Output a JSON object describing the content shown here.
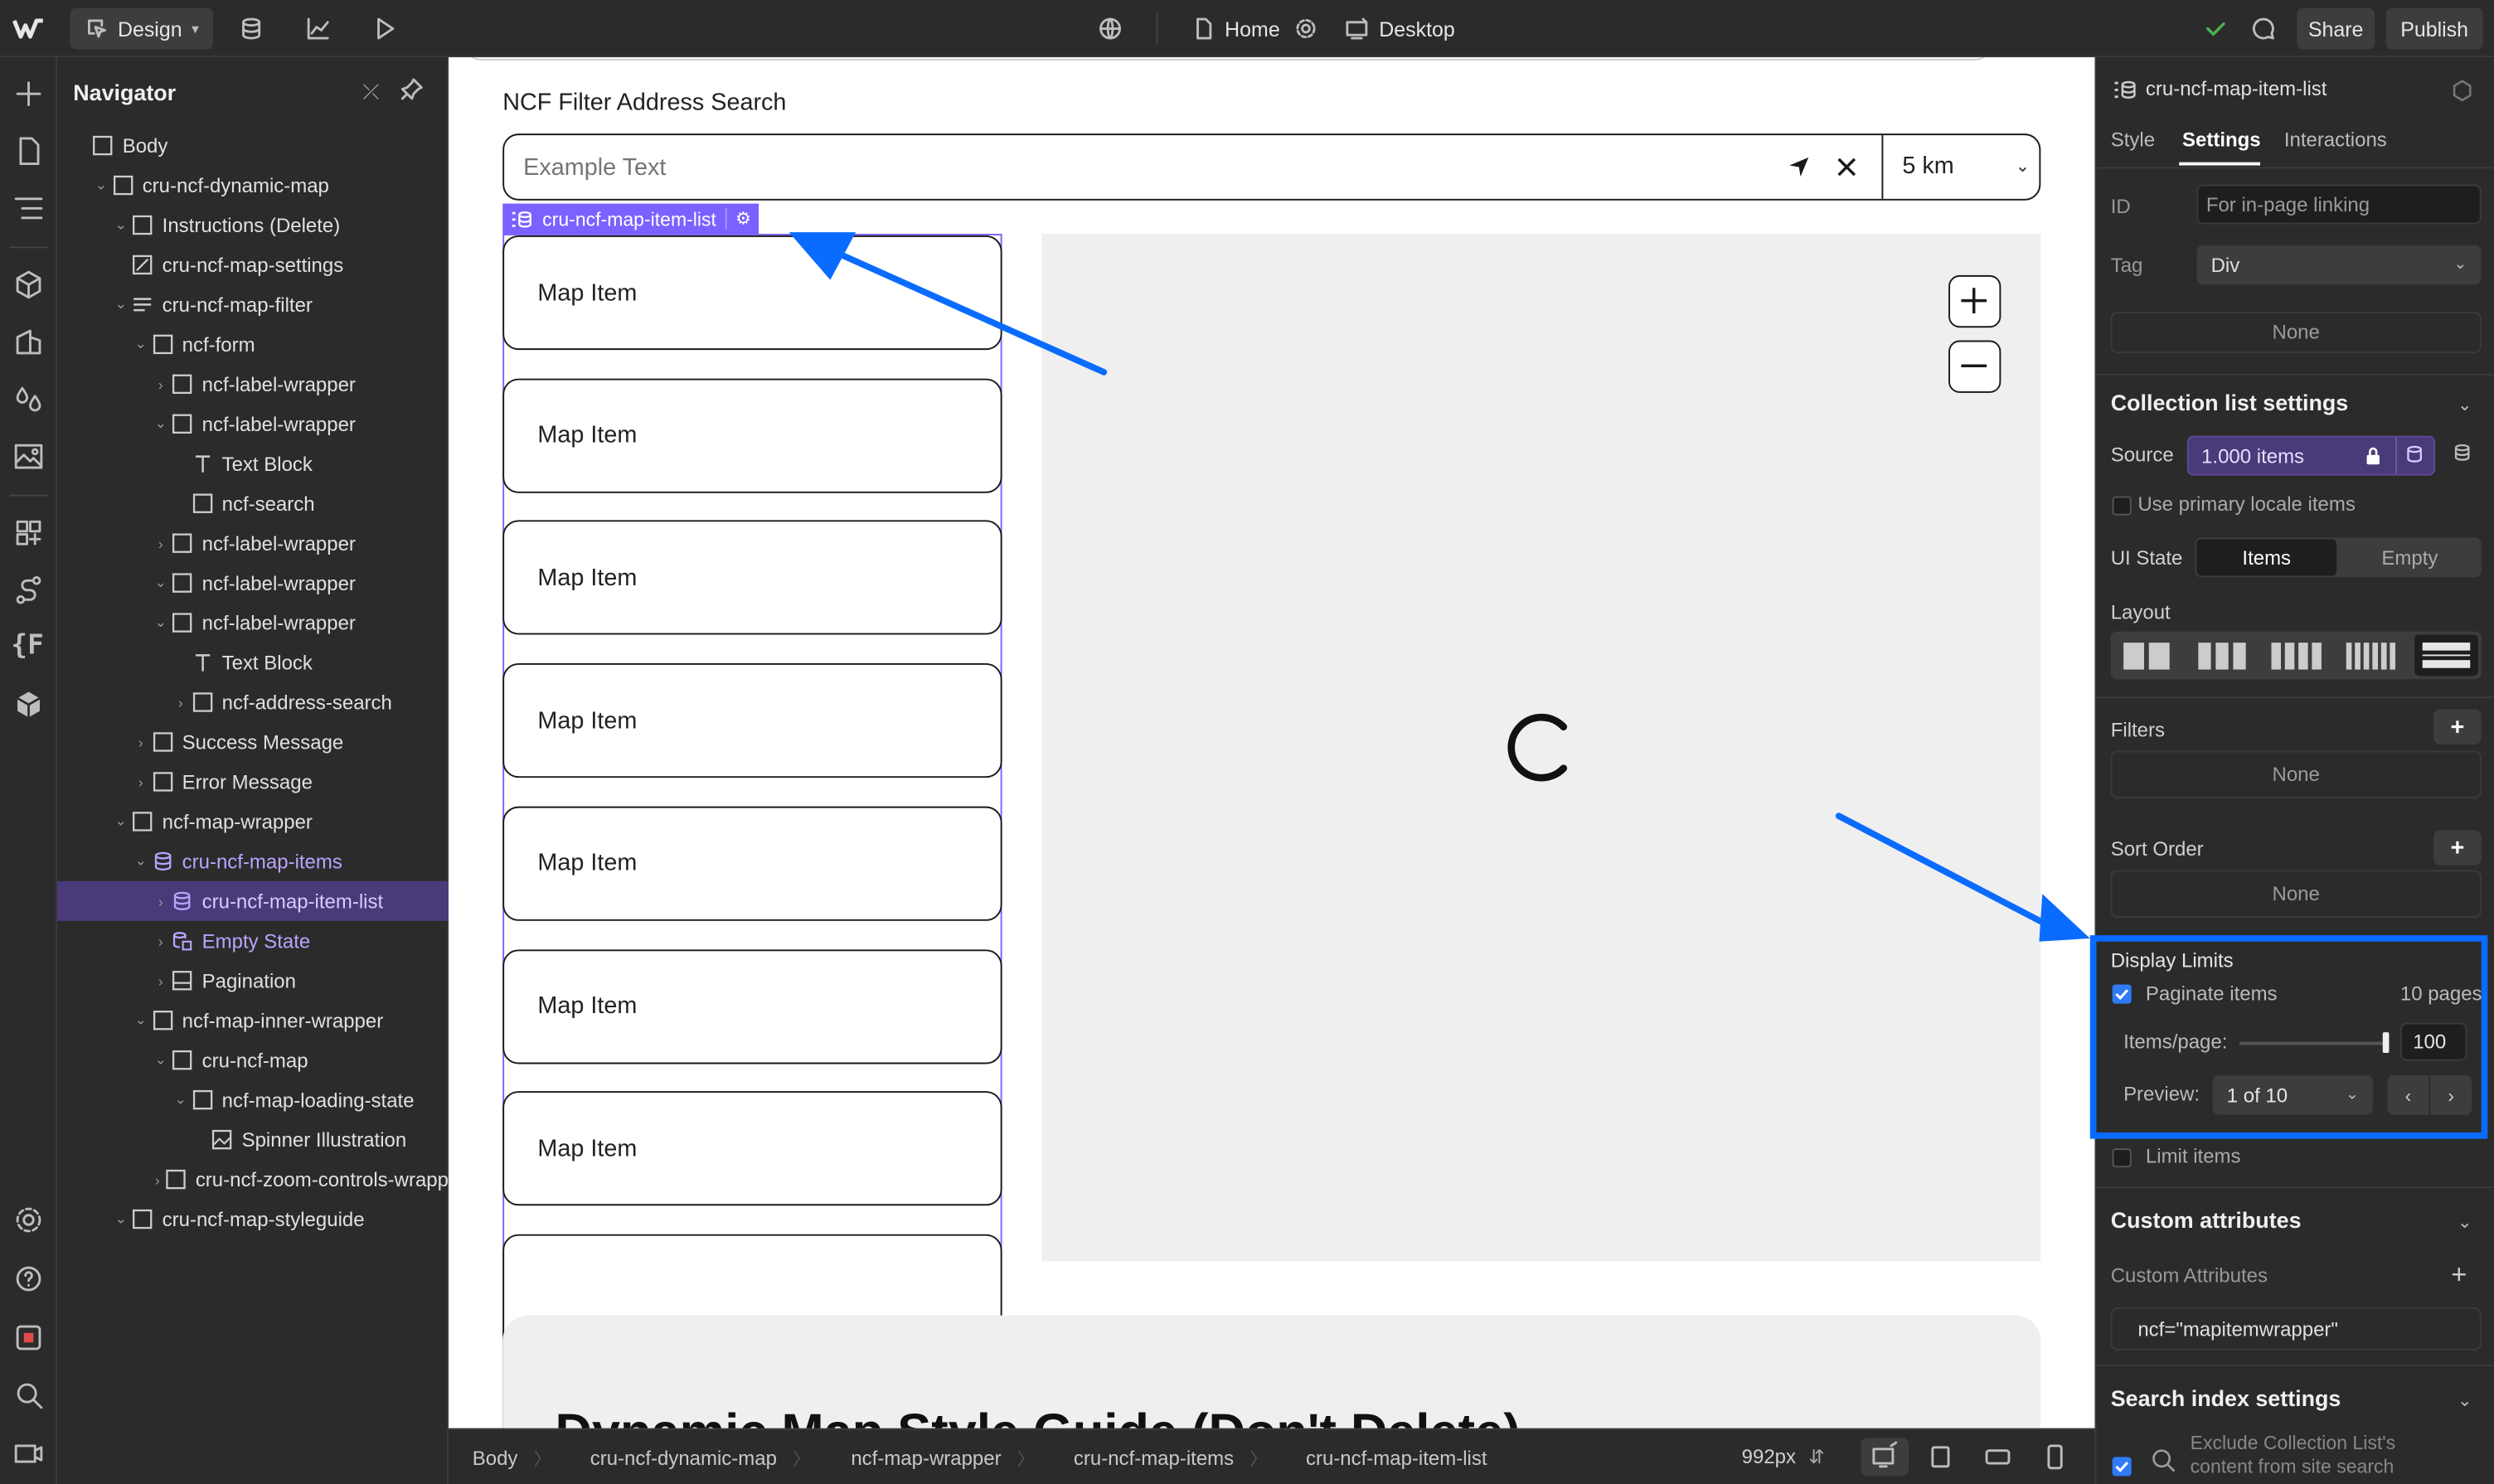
{
  "topbar": {
    "mode_label": "Design",
    "page_label": "Home",
    "breakpoint_label": "Desktop",
    "share_label": "Share",
    "publish_label": "Publish"
  },
  "navigator": {
    "title": "Navigator",
    "items": [
      {
        "label": "Body"
      },
      {
        "label": "cru-ncf-dynamic-map"
      },
      {
        "label": "Instructions (Delete)"
      },
      {
        "label": "cru-ncf-map-settings"
      },
      {
        "label": "cru-ncf-map-filter"
      },
      {
        "label": "ncf-form"
      },
      {
        "label": "ncf-label-wrapper"
      },
      {
        "label": "ncf-label-wrapper"
      },
      {
        "label": "Text Block"
      },
      {
        "label": "ncf-search"
      },
      {
        "label": "ncf-label-wrapper"
      },
      {
        "label": "ncf-label-wrapper"
      },
      {
        "label": "ncf-label-wrapper"
      },
      {
        "label": "Text Block"
      },
      {
        "label": "ncf-address-search"
      },
      {
        "label": "Success Message"
      },
      {
        "label": "Error Message"
      },
      {
        "label": "ncf-map-wrapper"
      },
      {
        "label": "cru-ncf-map-items"
      },
      {
        "label": "cru-ncf-map-item-list"
      },
      {
        "label": "Empty State"
      },
      {
        "label": "Pagination"
      },
      {
        "label": "ncf-map-inner-wrapper"
      },
      {
        "label": "cru-ncf-map"
      },
      {
        "label": "ncf-map-loading-state"
      },
      {
        "label": "Spinner Illustration"
      },
      {
        "label": "cru-ncf-zoom-controls-wrapp"
      },
      {
        "label": "cru-ncf-map-styleguide"
      }
    ]
  },
  "canvas": {
    "heading": "NCF Filter Address Search",
    "search_placeholder": "Example Text",
    "radius_value": "5 km",
    "selected_badge": "cru-ncf-map-item-list",
    "map_items": [
      "Map Item",
      "Map Item",
      "Map Item",
      "Map Item",
      "Map Item",
      "Map Item",
      "Map Item"
    ],
    "styleguide_heading": "Dynamic Map Style Guide (Don't Delete)"
  },
  "panel": {
    "element_name": "cru-ncf-map-item-list",
    "tabs": [
      "Style",
      "Settings",
      "Interactions"
    ],
    "id_label": "ID",
    "id_placeholder": "For in-page linking",
    "tag_label": "Tag",
    "tag_value": "Div",
    "none_label": "None",
    "collection_settings_title": "Collection list settings",
    "source_label": "Source",
    "source_value": "1.000 items",
    "primary_locale_label": "Use primary locale items",
    "ui_state_label": "UI State",
    "ui_state_items": "Items",
    "ui_state_empty": "Empty",
    "layout_label": "Layout",
    "filters_label": "Filters",
    "filters_value": "None",
    "sort_label": "Sort Order",
    "sort_value": "None",
    "display_limits_label": "Display Limits",
    "paginate_label": "Paginate items",
    "pages_count": "10 pages",
    "items_per_page_label": "Items/page:",
    "items_per_page_value": "100",
    "items_per_page_fraction": 1.0,
    "preview_label": "Preview:",
    "preview_value": "1 of 10",
    "limit_items_label": "Limit items",
    "custom_attributes_title": "Custom attributes",
    "custom_attributes_label": "Custom Attributes",
    "custom_attribute_value": "ncf=\"mapitemwrapper\"",
    "search_index_title": "Search index settings",
    "exclude_label_line1": "Exclude Collection List's",
    "exclude_label_line2": "content from site search"
  },
  "bottombar": {
    "crumbs": [
      "Body",
      "cru-ncf-dynamic-map",
      "ncf-map-wrapper",
      "cru-ncf-map-items",
      "cru-ncf-map-item-list"
    ],
    "width_value": "992px"
  },
  "colors": {
    "accent": "#7b61ff",
    "annotation": "#0a6cff",
    "check": "#4caf50"
  }
}
